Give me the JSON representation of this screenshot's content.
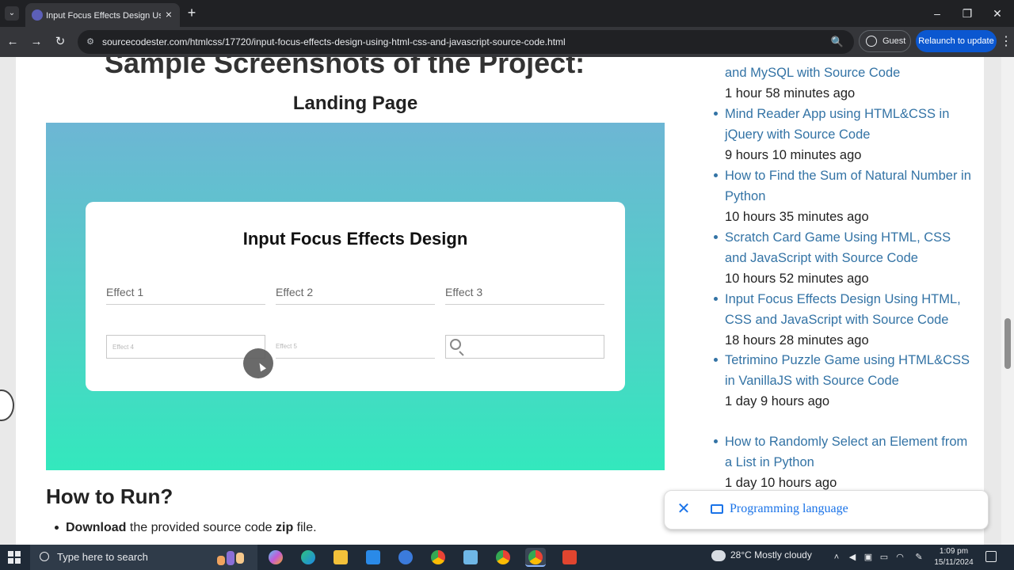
{
  "browser": {
    "tab_title": "Input Focus Effects Design Using HTML",
    "url": "sourcecodester.com/htmlcss/17720/input-focus-effects-design-using-html-css-and-javascript-source-code.html",
    "guest_label": "Guest",
    "relaunch_label": "Relaunch to update",
    "tab_list_icon": "⌄",
    "close_tab_icon": "×",
    "new_tab_icon": "+",
    "minimize_icon": "–",
    "maximize_icon": "❐",
    "close_window_icon": "✕",
    "back_icon": "←",
    "forward_icon": "→",
    "reload_icon": "↻",
    "site_info_icon": "⚙",
    "zoom_icon": "🔍",
    "menu_icon": "⋮"
  },
  "article": {
    "heading_samples": "Sample Screenshots of the Project:",
    "heading_landing": "Landing Page",
    "screenshot": {
      "card_title": "Input Focus Effects Design",
      "effect1": "Effect 1",
      "effect2": "Effect 2",
      "effect3": "Effect 3",
      "effect4": "Effect 4",
      "effect5": "Effect 5"
    },
    "heading_run": "How to Run?",
    "run_steps": [
      {
        "bold": "Download",
        "text": " the provided source code ",
        "bold2": "zip",
        "text2": " file."
      }
    ]
  },
  "sidebar": {
    "posts": [
      {
        "title": "and MySQL with Source Code",
        "time": "1 hour 58 minutes ago"
      },
      {
        "title": "Mind Reader App using HTML&CSS in jQuery with Source Code",
        "time": "9 hours 10 minutes ago"
      },
      {
        "title": "How to Find the Sum of Natural Number in Python",
        "time": "10 hours 35 minutes ago"
      },
      {
        "title": "Scratch Card Game Using HTML, CSS and JavaScript with Source Code",
        "time": "10 hours 52 minutes ago"
      },
      {
        "title": "Input Focus Effects Design Using HTML, CSS and JavaScript with Source Code",
        "time": "18 hours 28 minutes ago"
      },
      {
        "title": "Tetrimino Puzzle Game using HTML&CSS in VanillaJS with Source Code",
        "time": "1 day 9 hours ago"
      },
      {
        "title": "How to Randomly Select an Element from a List in Python",
        "time": "1 day 10 hours ago"
      }
    ]
  },
  "toast": {
    "close_icon": "✕",
    "text": "Programming language"
  },
  "taskbar": {
    "search_placeholder": "Type here to search",
    "weather": "28°C  Mostly cloudy",
    "time": "1:09 pm",
    "date": "15/11/2024"
  }
}
